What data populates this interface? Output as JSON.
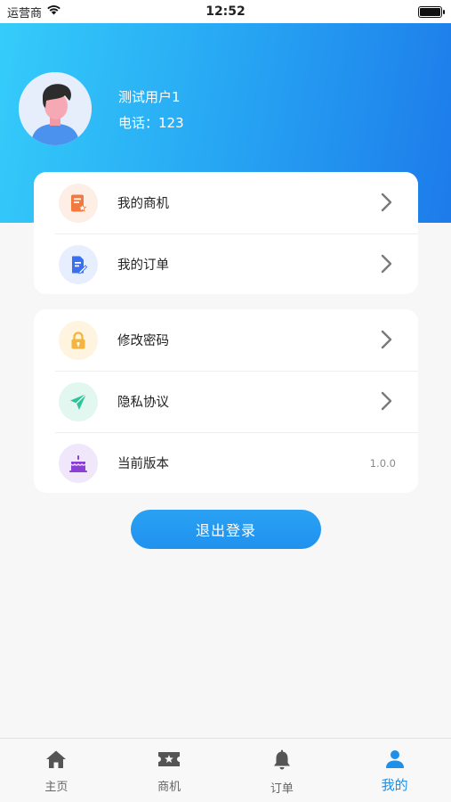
{
  "status_bar": {
    "carrier": "运营商",
    "time": "12:52"
  },
  "profile": {
    "name": "测试用户1",
    "phone": "电话：123"
  },
  "menu_group_1": [
    {
      "label": "我的商机",
      "icon": "document-star-icon",
      "icon_color": "#f07a3f",
      "icon_bg": "#fdeee6"
    },
    {
      "label": "我的订单",
      "icon": "document-edit-icon",
      "icon_color": "#3a6ff0",
      "icon_bg": "#e7effe"
    }
  ],
  "menu_group_2": [
    {
      "label": "修改密码",
      "icon": "lock-icon",
      "icon_color": "#f3b53a",
      "icon_bg": "#fff4df"
    },
    {
      "label": "隐私协议",
      "icon": "paper-plane-icon",
      "icon_color": "#2dc49a",
      "icon_bg": "#e3f7f1"
    },
    {
      "label": "当前版本",
      "icon": "cake-icon",
      "icon_color": "#8a3fd6",
      "icon_bg": "#f1e7fb",
      "value": "1.0.0"
    }
  ],
  "logout_label": "退出登录",
  "tabs": [
    {
      "label": "主页",
      "icon": "home-icon",
      "active": false
    },
    {
      "label": "商机",
      "icon": "ticket-icon",
      "active": false
    },
    {
      "label": "订单",
      "icon": "bell-icon",
      "active": false
    },
    {
      "label": "我的",
      "icon": "person-icon",
      "active": true
    }
  ],
  "colors": {
    "primary": "#1f8fe8",
    "header_gradient_start": "#35cdfa",
    "header_gradient_end": "#1d7bea"
  }
}
